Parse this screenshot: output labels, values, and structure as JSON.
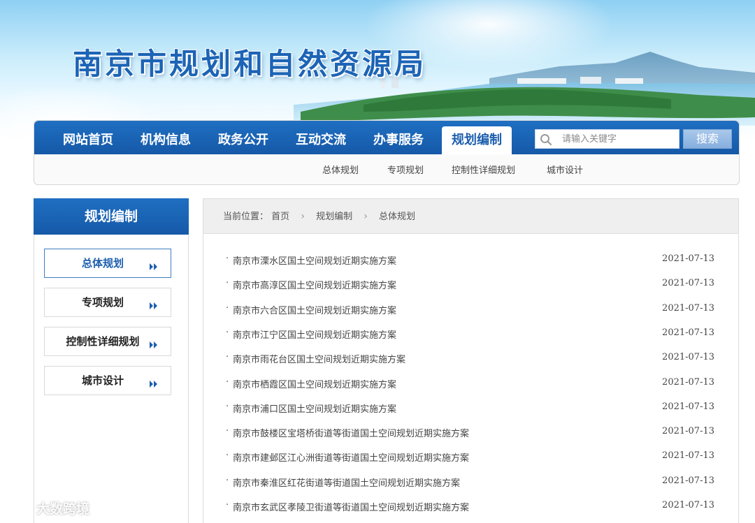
{
  "header": {
    "site_title": "南京市规划和自然资源局"
  },
  "nav": {
    "items": [
      {
        "label": "网站首页",
        "active": false
      },
      {
        "label": "机构信息",
        "active": false
      },
      {
        "label": "政务公开",
        "active": false
      },
      {
        "label": "互动交流",
        "active": false
      },
      {
        "label": "办事服务",
        "active": false
      },
      {
        "label": "规划编制",
        "active": true
      }
    ],
    "search_placeholder": "请输入关键字",
    "search_button": "搜索"
  },
  "subnav": {
    "items": [
      "总体规划",
      "专项规划",
      "控制性详细规划",
      "城市设计"
    ]
  },
  "sidebar": {
    "title": "规划编制",
    "items": [
      {
        "label": "总体规划",
        "active": true
      },
      {
        "label": "专项规划",
        "active": false
      },
      {
        "label": "控制性详细规划",
        "active": false
      },
      {
        "label": "城市设计",
        "active": false
      }
    ]
  },
  "breadcrumb": {
    "prefix": "当前位置：",
    "items": [
      "首页",
      "规划编制",
      "总体规划"
    ]
  },
  "list": {
    "items": [
      {
        "title": "南京市溧水区国土空间规划近期实施方案",
        "date": "2021-07-13"
      },
      {
        "title": "南京市高淳区国土空间规划近期实施方案",
        "date": "2021-07-13"
      },
      {
        "title": "南京市六合区国土空间规划近期实施方案",
        "date": "2021-07-13"
      },
      {
        "title": "南京市江宁区国土空间规划近期实施方案",
        "date": "2021-07-13"
      },
      {
        "title": "南京市雨花台区国土空间规划近期实施方案",
        "date": "2021-07-13"
      },
      {
        "title": "南京市栖霞区国土空间规划近期实施方案",
        "date": "2021-07-13"
      },
      {
        "title": "南京市浦口区国土空间规划近期实施方案",
        "date": "2021-07-13"
      },
      {
        "title": "南京市鼓楼区宝塔桥街道等街道国土空间规划近期实施方案",
        "date": "2021-07-13"
      },
      {
        "title": "南京市建邺区江心洲街道等街道国土空间规划近期实施方案",
        "date": "2021-07-13"
      },
      {
        "title": "南京市秦淮区红花街道等街道国土空间规划近期实施方案",
        "date": "2021-07-13"
      },
      {
        "title": "南京市玄武区孝陵卫街道等街道国土空间规划近期实施方案",
        "date": "2021-07-13"
      }
    ]
  },
  "watermark": {
    "text": "大数跨境"
  },
  "colors": {
    "nav_blue": "#1c64b6",
    "title_blue": "#1c64b6",
    "search_button": "#95b9e2"
  }
}
